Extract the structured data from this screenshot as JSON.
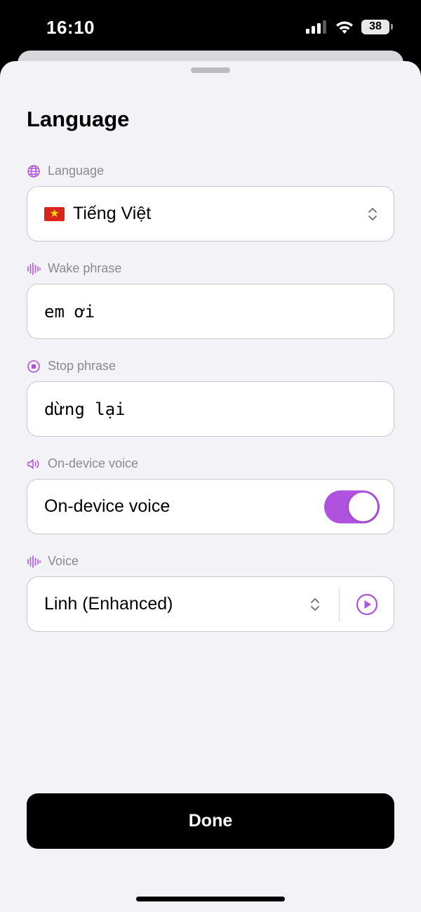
{
  "status_bar": {
    "time": "16:10",
    "battery": "38"
  },
  "sheet": {
    "title": "Language",
    "language": {
      "label": "Language",
      "flag": "★",
      "value": "Tiếng Việt"
    },
    "wake_phrase": {
      "label": "Wake phrase",
      "value": "em ơi"
    },
    "stop_phrase": {
      "label": "Stop phrase",
      "value": "dừng lại"
    },
    "on_device_voice": {
      "label": "On-device voice",
      "row_label": "On-device voice",
      "enabled": true
    },
    "voice": {
      "label": "Voice",
      "value": "Linh (Enhanced)"
    },
    "done_label": "Done"
  },
  "colors": {
    "accent": "#af52de",
    "background": "#f2f2f7",
    "label_gray": "#8a8a8e"
  },
  "icons": [
    "globe-icon",
    "waveform-icon",
    "stop-circle-icon",
    "speaker-icon",
    "chevron-updown-icon",
    "play-circle-icon"
  ]
}
